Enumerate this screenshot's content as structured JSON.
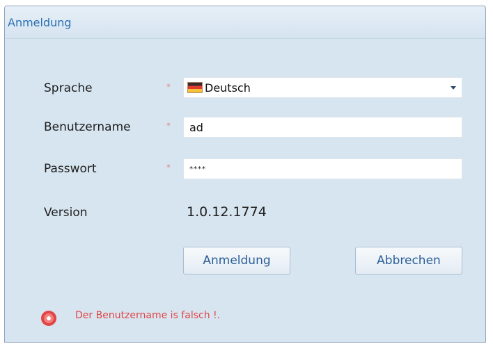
{
  "window": {
    "title": "Anmeldung"
  },
  "form": {
    "language": {
      "label": "Sprache",
      "required_mark": "*",
      "value": "Deutsch",
      "flag_icon": "german-flag-icon"
    },
    "username": {
      "label": "Benutzername",
      "required_mark": "*",
      "value": "ad"
    },
    "password": {
      "label": "Passwort",
      "required_mark": "*",
      "value": "****"
    },
    "version": {
      "label": "Version",
      "value": "1.0.12.1774"
    }
  },
  "buttons": {
    "login": "Anmeldung",
    "cancel": "Abbrechen"
  },
  "error": {
    "icon": "error-icon",
    "message": "Der Benutzername is falsch !."
  },
  "colors": {
    "accent_title": "#2a6fb4",
    "error": "#e04545",
    "background": "#d7e5f0"
  }
}
